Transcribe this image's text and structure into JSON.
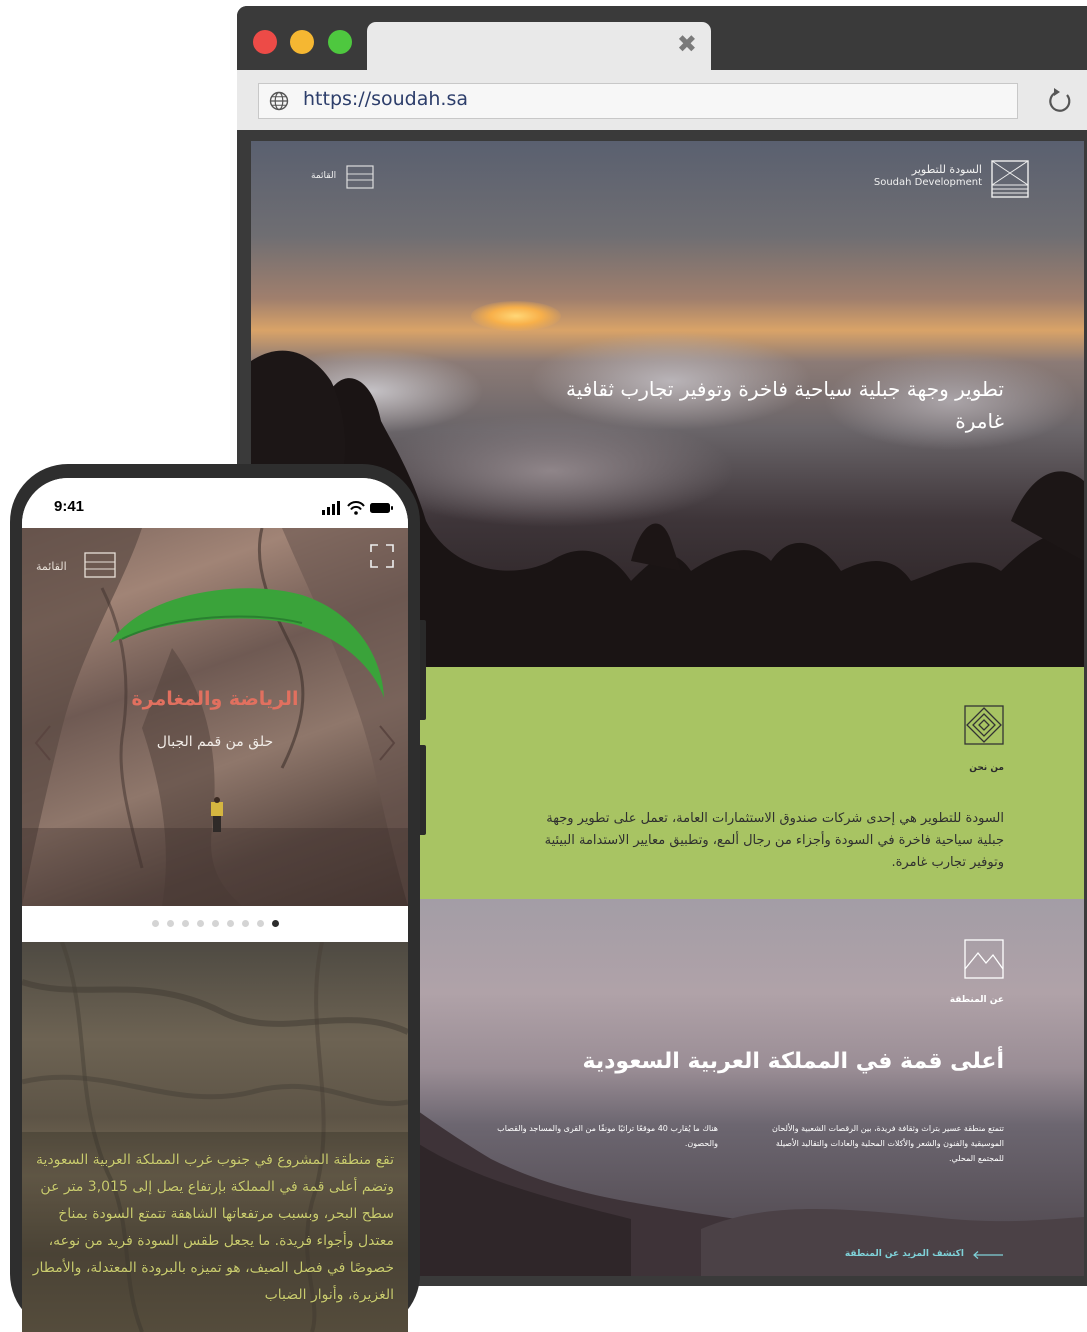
{
  "browser": {
    "url": "https://soudah.sa",
    "tab_close": "✖"
  },
  "site": {
    "logo_ar": "السودة للتطوير",
    "logo_en": "Soudah Development",
    "menu_label": "القائمة",
    "hero_title": "تطوير وجهة جبلية سياحية فاخرة وتوفير تجارب ثقافية غامرة",
    "about": {
      "label": "من نحن",
      "text": "السودة للتطوير هي إحدى شركات صندوق الاستثمارات العامة، تعمل على تطوير وجهة جبلية سياحية فاخرة في السودة وأجزاء من رجال ألمع، وتطبيق معايير الاستدامة البيئية وتوفير تجارب غامرة."
    },
    "region": {
      "label": "عن المنطقة",
      "title": "أعلى قمة في المملكة العربية السعودية",
      "col_right": "تتمتع منطقة عسير بتراث وثقافة فريدة، بين الرقصات الشعبية والألحان الموسيقية والفنون والشعر والأكلات المحلية والعادات والتقاليد الأصيلة للمجتمع المحلي.",
      "col_left": "هناك ما يُقارب 40 موقعًا تراثيًا مونقًا من القرى والمساجد والقصاب والحصون.",
      "link": "اكتشف المزيد عن المنطقة"
    }
  },
  "phone": {
    "time": "9:41",
    "menu_label": "القائمة",
    "slide_title": "الرياضة والمغامرة",
    "slide_subtitle": "حلق من قمم الجبال",
    "pager": {
      "count": 9,
      "active_index": 8
    },
    "body_text": "تقع منطقة المشروع في جنوب غرب المملكة العربية السعودية وتضم أعلى قمة في المملكة بإرتفاع يصل إلى 3,015 متر عن سطح البحر، وبسبب مرتفعاتها الشاهقة تتمتع السودة بمناخ معتدل وأجواء فريدة. ما يجعل طقس السودة فريد من نوعه، خصوصًا في فصل الصيف، هو تميزه بالبرودة المعتدلة، والأمطار الغزيرة، وأنوار الضباب"
  },
  "colors": {
    "about_bg": "#a8c463",
    "slide_title": "#e1705f",
    "link": "#7fd1d8",
    "phone_text": "#c9cb6e"
  },
  "icons": [
    "globe-icon",
    "reload-icon",
    "menu-icon",
    "soudah-logo-icon",
    "diamond-icon",
    "mountain-frame-icon",
    "arrow-left-icon",
    "expand-icon",
    "chevron-left-icon",
    "chevron-right-icon",
    "signal-icon",
    "wifi-icon",
    "battery-icon"
  ]
}
